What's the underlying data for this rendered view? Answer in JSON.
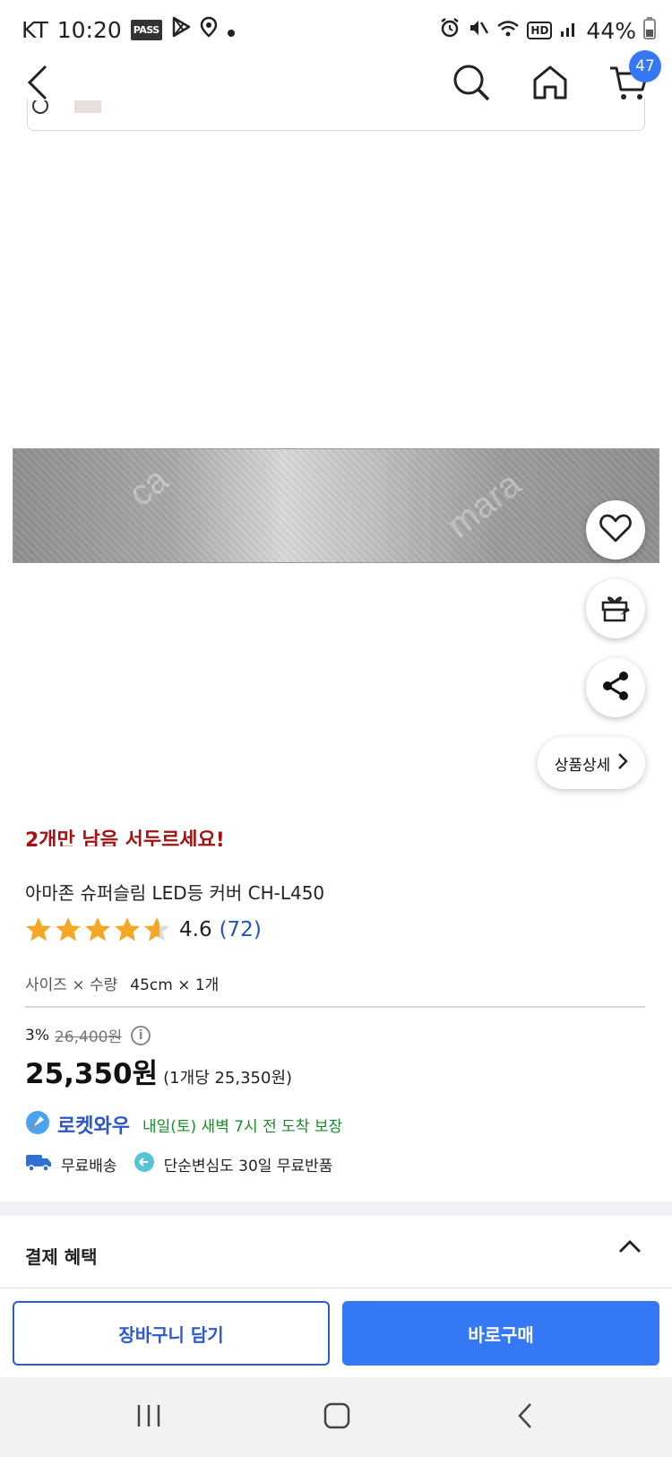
{
  "status_bar": {
    "carrier": "KT",
    "time": "10:20",
    "pass_label": "PASS",
    "hd_label": "HD",
    "battery": "44%"
  },
  "header": {
    "cart_count": "47"
  },
  "product": {
    "stock_warning": "2개만 남음 서두르세요!",
    "title": "아마존 슈퍼슬림 LED등 커버 CH-L450",
    "rating": "4.6",
    "rating_fraction": 0.92,
    "review_count": "(72)",
    "option_label": "사이즈 × 수량",
    "option_value": "45cm × 1개",
    "discount": "3%",
    "original_price": "26,400원",
    "final_price": "25,350원",
    "unit_price": "(1개당 25,350원)",
    "rocket_label": "로켓와우",
    "delivery_text": "내일(토) 새벽 7시 전 도착 보장",
    "free_shipping": "무료배송",
    "free_return": "단순변심도 30일 무료반품"
  },
  "detail_chip": {
    "label": "상품상세"
  },
  "benefits": {
    "label": "결제 혜택"
  },
  "actions": {
    "add_to_cart": "장바구니 담기",
    "buy_now": "바로구매"
  },
  "colors": {
    "accent_blue": "#3478f6",
    "rocket_blue": "#2d55c7",
    "delivery_green": "#1b8a2b",
    "warning_red": "#a51212",
    "star_gold": "#f5a623"
  },
  "icons": {
    "back": "back-arrow-icon",
    "search": "search-icon",
    "home": "home-icon",
    "cart": "cart-icon",
    "heart": "heart-icon",
    "gift": "gift-icon",
    "share": "share-icon"
  }
}
